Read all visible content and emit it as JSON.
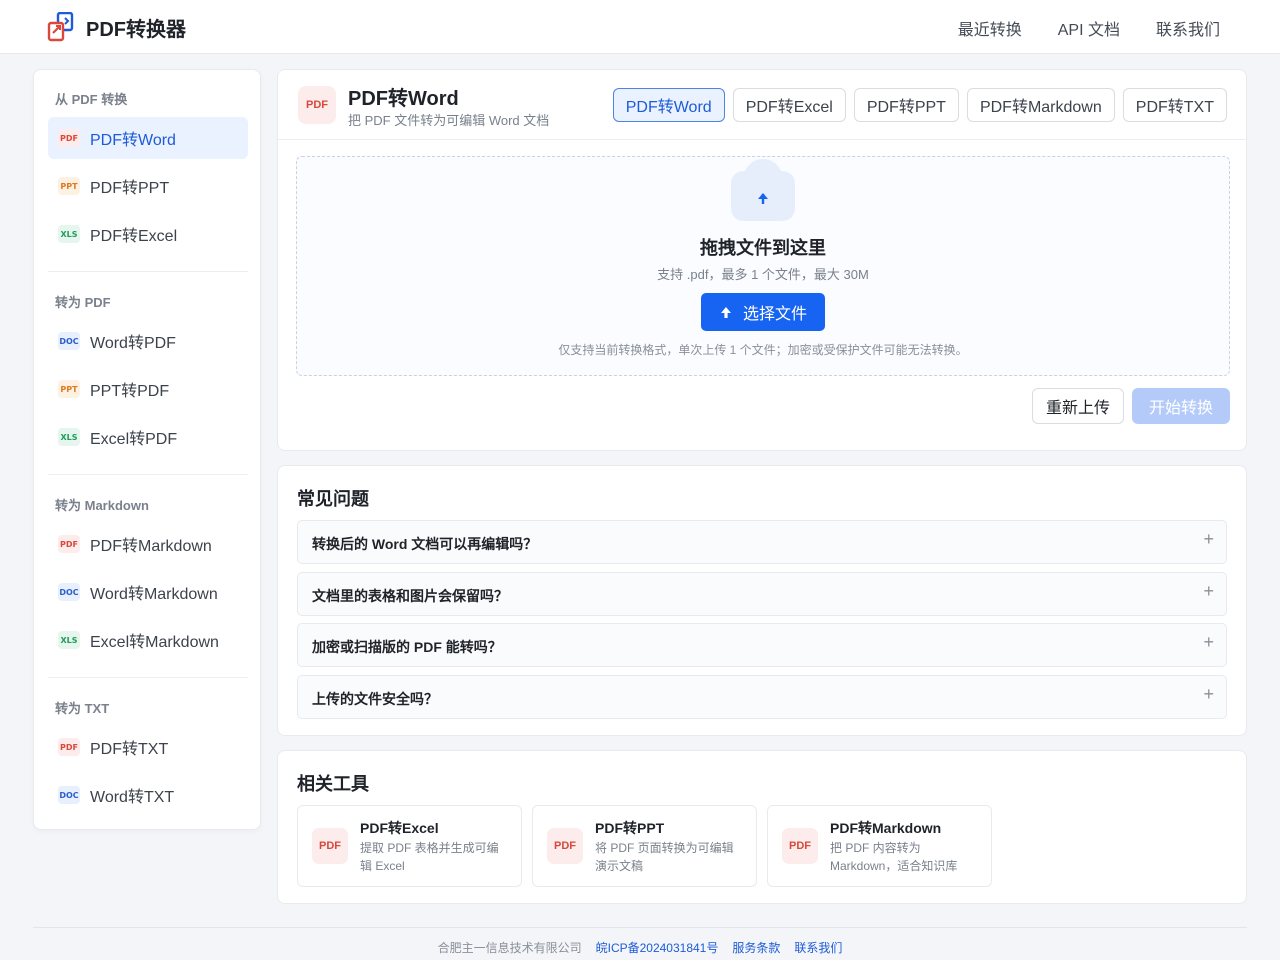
{
  "header": {
    "brand": "PDF转换器",
    "nav": [
      "最近转换",
      "API 文档",
      "联系我们"
    ]
  },
  "sidebar": {
    "groups": [
      {
        "title": "从 PDF 转换",
        "items": [
          {
            "tag": "PDF",
            "label": "PDF转Word",
            "active": true
          },
          {
            "tag": "PPT",
            "label": "PDF转PPT"
          },
          {
            "tag": "XLS",
            "label": "PDF转Excel"
          }
        ]
      },
      {
        "title": "转为 PDF",
        "items": [
          {
            "tag": "DOC",
            "label": "Word转PDF"
          },
          {
            "tag": "PPT",
            "label": "PPT转PDF"
          },
          {
            "tag": "XLS",
            "label": "Excel转PDF"
          }
        ]
      },
      {
        "title": "转为 Markdown",
        "items": [
          {
            "tag": "PDF",
            "label": "PDF转Markdown"
          },
          {
            "tag": "DOC",
            "label": "Word转Markdown"
          },
          {
            "tag": "XLS",
            "label": "Excel转Markdown"
          }
        ]
      },
      {
        "title": "转为 TXT",
        "items": [
          {
            "tag": "PDF",
            "label": "PDF转TXT"
          },
          {
            "tag": "DOC",
            "label": "Word转TXT"
          }
        ]
      }
    ]
  },
  "converter": {
    "icon_tag": "PDF",
    "title": "PDF转Word",
    "subtitle": "把 PDF 文件转为可编辑 Word 文档",
    "tabs": [
      "PDF转Word",
      "PDF转Excel",
      "PDF转PPT",
      "PDF转Markdown",
      "PDF转TXT"
    ],
    "active_tab": 0,
    "dropzone": {
      "title": "拖拽文件到这里",
      "hint": "支持 .pdf，最多 1 个文件，最大 30M",
      "button": "选择文件",
      "note": "仅支持当前转换格式，单次上传 1 个文件；加密或受保护文件可能无法转换。"
    },
    "reupload_label": "重新上传",
    "start_label": "开始转换"
  },
  "faq": {
    "title": "常见问题",
    "items": [
      "转换后的 Word 文档可以再编辑吗？",
      "文档里的表格和图片会保留吗？",
      "加密或扫描版的 PDF 能转吗？",
      "上传的文件安全吗？"
    ],
    "expand_symbol": "+"
  },
  "related": {
    "title": "相关工具",
    "items": [
      {
        "tag": "PDF",
        "title": "PDF转Excel",
        "desc": "提取 PDF 表格并生成可编辑 Excel"
      },
      {
        "tag": "PDF",
        "title": "PDF转PPT",
        "desc": "将 PDF 页面转换为可编辑演示文稿"
      },
      {
        "tag": "PDF",
        "title": "PDF转Markdown",
        "desc": "把 PDF 内容转为 Markdown，适合知识库"
      }
    ]
  },
  "footer": {
    "company": "合肥主一信息技术有限公司",
    "icp": "皖ICP备2024031841号",
    "terms": "服务条款",
    "contact": "联系我们"
  },
  "colors": {
    "primary": "#1764f2",
    "active_bg": "#ebf2ff",
    "disabled_primary": "#b4cbfa",
    "pdf_red": "#d9483b"
  }
}
